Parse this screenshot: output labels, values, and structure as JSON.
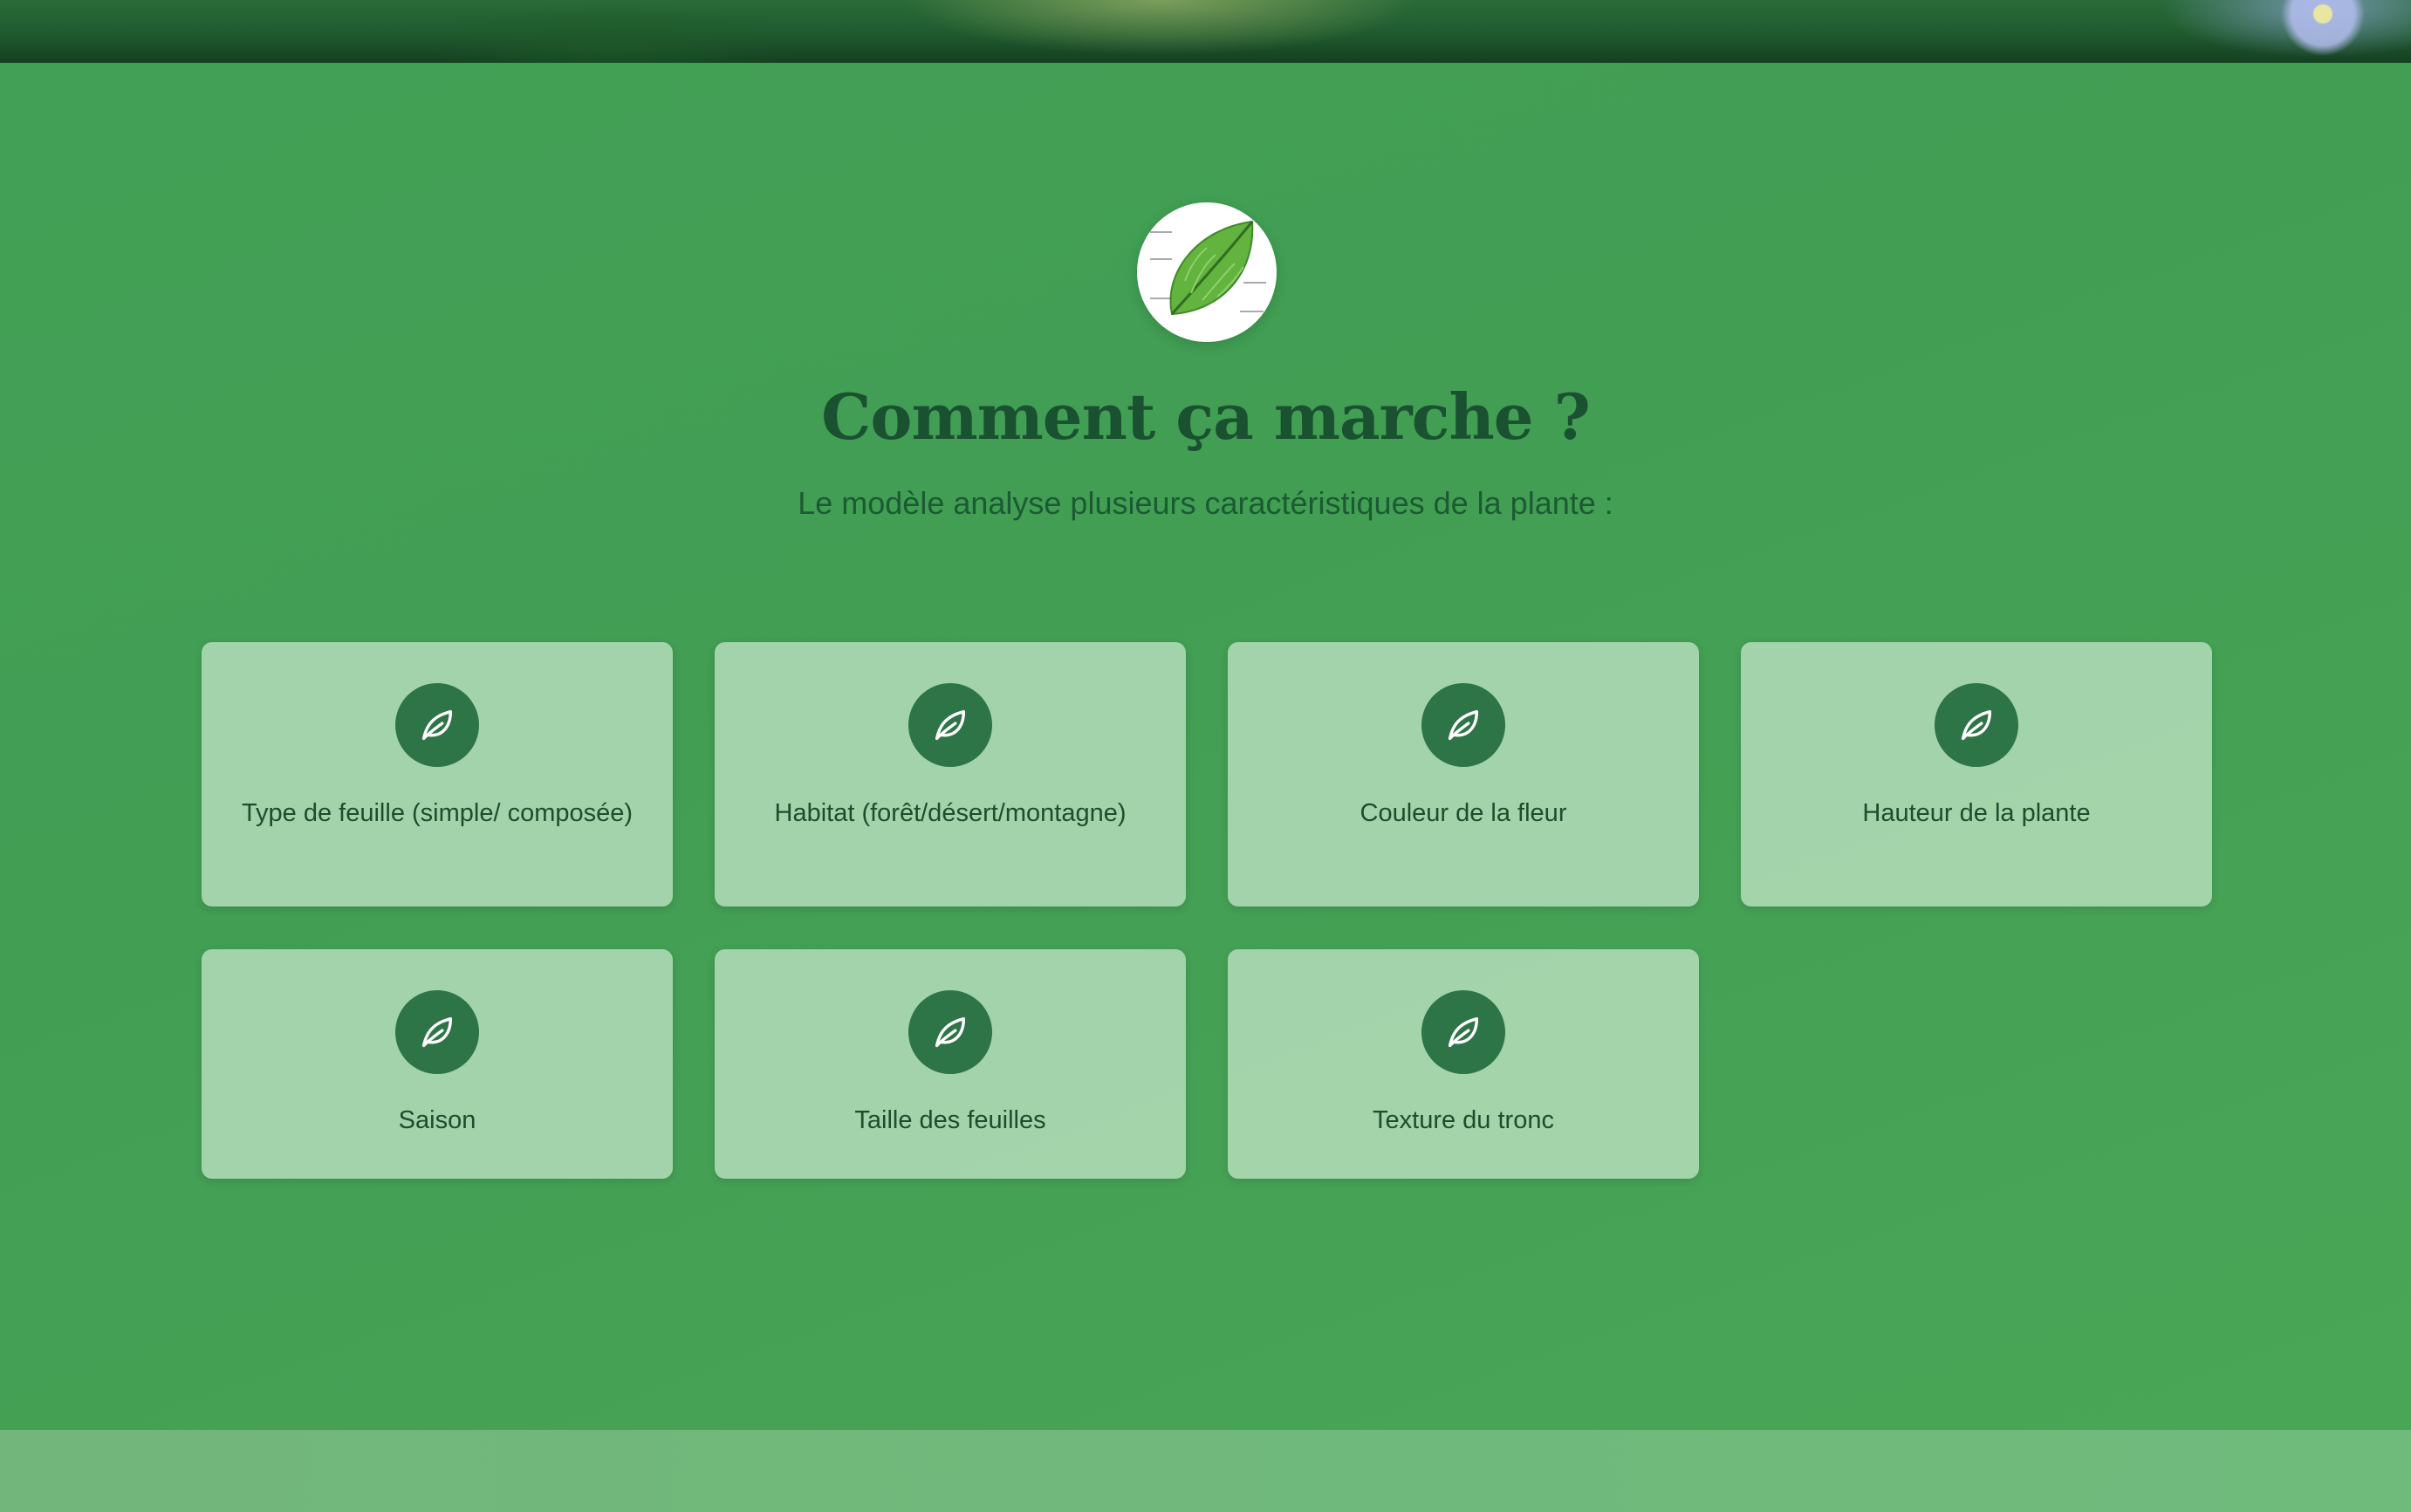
{
  "section": {
    "title": "Comment ça marche ?",
    "subtitle": "Le modèle analyse plusieurs caractéristiques de la plante :"
  },
  "features": [
    {
      "label": "Type de feuille (simple/ composée)",
      "icon": "leaf-icon"
    },
    {
      "label": "Habitat (forêt/désert/montagne)",
      "icon": "leaf-icon"
    },
    {
      "label": "Couleur de la fleur",
      "icon": "leaf-icon"
    },
    {
      "label": "Hauteur de la plante",
      "icon": "leaf-icon"
    },
    {
      "label": "Saison",
      "icon": "leaf-icon"
    },
    {
      "label": "Taille des feuilles",
      "icon": "leaf-icon"
    },
    {
      "label": "Texture du tronc",
      "icon": "leaf-icon"
    }
  ],
  "colors": {
    "background": "#43a055",
    "card": "#bee1c3",
    "icon_badge": "#2d7446",
    "title": "#1a5130",
    "footer": "#72b67b"
  }
}
